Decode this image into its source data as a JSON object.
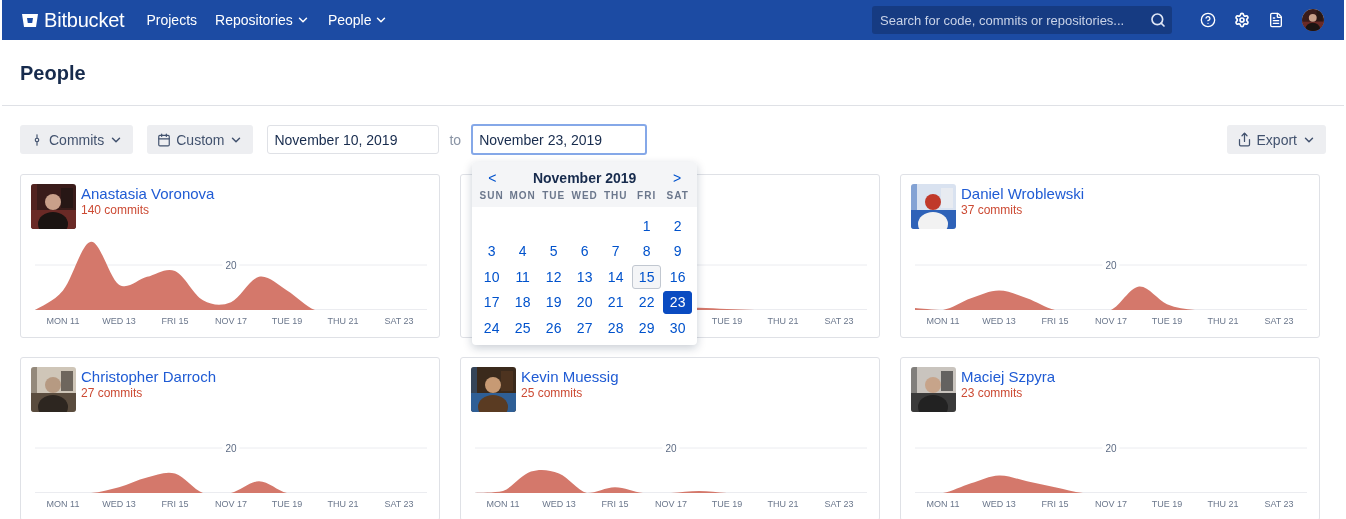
{
  "navbar": {
    "logo": "Bitbucket",
    "items": [
      {
        "label": "Projects",
        "dropdown": false
      },
      {
        "label": "Repositories",
        "dropdown": true
      },
      {
        "label": "People",
        "dropdown": true
      }
    ],
    "search": {
      "placeholder": "Search for code, commits or repositories..."
    }
  },
  "page_title": "People",
  "toolbar": {
    "metric": "Commits",
    "range": "Custom",
    "from": "November 10, 2019",
    "separator": "to",
    "to": "November 23, 2019",
    "export": "Export"
  },
  "calendar": {
    "prev": "<",
    "month": "November 2019",
    "next": ">",
    "weekdays": [
      "SUN",
      "MON",
      "TUE",
      "WED",
      "THU",
      "FRI",
      "SAT"
    ],
    "weeks": [
      {
        "days": [
          {
            "label": "1",
            "today": false,
            "selected": false
          },
          {
            "label": "2",
            "today": false,
            "selected": false
          }
        ]
      },
      {
        "days": [
          {
            "label": "3",
            "today": false,
            "selected": false
          },
          {
            "label": "4",
            "today": false,
            "selected": false
          },
          {
            "label": "5",
            "today": false,
            "selected": false
          },
          {
            "label": "6",
            "today": false,
            "selected": false
          },
          {
            "label": "7",
            "today": false,
            "selected": false
          },
          {
            "label": "8",
            "today": false,
            "selected": false
          },
          {
            "label": "9",
            "today": false,
            "selected": false
          }
        ]
      },
      {
        "days": [
          {
            "label": "10",
            "today": false,
            "selected": false
          },
          {
            "label": "11",
            "today": false,
            "selected": false
          },
          {
            "label": "12",
            "today": false,
            "selected": false
          },
          {
            "label": "13",
            "today": false,
            "selected": false
          },
          {
            "label": "14",
            "today": false,
            "selected": false
          },
          {
            "label": "15",
            "today": true,
            "selected": false
          },
          {
            "label": "16",
            "today": false,
            "selected": false
          }
        ]
      },
      {
        "days": [
          {
            "label": "17",
            "today": false,
            "selected": false
          },
          {
            "label": "18",
            "today": false,
            "selected": false
          },
          {
            "label": "19",
            "today": false,
            "selected": false
          },
          {
            "label": "20",
            "today": false,
            "selected": false
          },
          {
            "label": "21",
            "today": false,
            "selected": false
          },
          {
            "label": "22",
            "today": false,
            "selected": false
          },
          {
            "label": "23",
            "today": false,
            "selected": true
          }
        ]
      },
      {
        "days": [
          {
            "label": "24",
            "today": false,
            "selected": false
          },
          {
            "label": "25",
            "today": false,
            "selected": false
          },
          {
            "label": "26",
            "today": false,
            "selected": false
          },
          {
            "label": "27",
            "today": false,
            "selected": false
          },
          {
            "label": "28",
            "today": false,
            "selected": false
          },
          {
            "label": "29",
            "today": false,
            "selected": false
          },
          {
            "label": "30",
            "today": false,
            "selected": false
          }
        ]
      }
    ]
  },
  "cards": [
    {
      "kind": "person",
      "name": "Anastasia Voronova",
      "commits": "140 commits",
      "gridline": "20",
      "axis_labels": [
        "MON 11",
        "WED 13",
        "FRI 15",
        "NOV 17",
        "TUE 19",
        "THU 21",
        "SAT 23"
      ]
    },
    {
      "kind": "covered",
      "axis_labels": [
        "TUE 19",
        "THU 21",
        "SAT 23"
      ]
    },
    {
      "kind": "person",
      "name": "Daniel Wroblewski",
      "commits": "37 commits",
      "gridline": "20",
      "axis_labels": [
        "MON 11",
        "WED 13",
        "FRI 15",
        "NOV 17",
        "TUE 19",
        "THU 21",
        "SAT 23"
      ]
    },
    {
      "kind": "person",
      "name": "Christopher Darroch",
      "commits": "27 commits",
      "gridline": "20",
      "axis_labels": [
        "MON 11",
        "WED 13",
        "FRI 15",
        "NOV 17",
        "TUE 19",
        "THU 21",
        "SAT 23"
      ]
    },
    {
      "kind": "person",
      "name": "Kevin Muessig",
      "commits": "25 commits",
      "gridline": "20",
      "axis_labels": [
        "MON 11",
        "WED 13",
        "FRI 15",
        "NOV 17",
        "TUE 19",
        "THU 21",
        "SAT 23"
      ]
    },
    {
      "kind": "person",
      "name": "Maciej Szpyra",
      "commits": "23 commits",
      "gridline": "20",
      "axis_labels": [
        "MON 11",
        "WED 13",
        "FRI 15",
        "NOV 17",
        "TUE 19",
        "THU 21",
        "SAT 23"
      ]
    }
  ]
}
